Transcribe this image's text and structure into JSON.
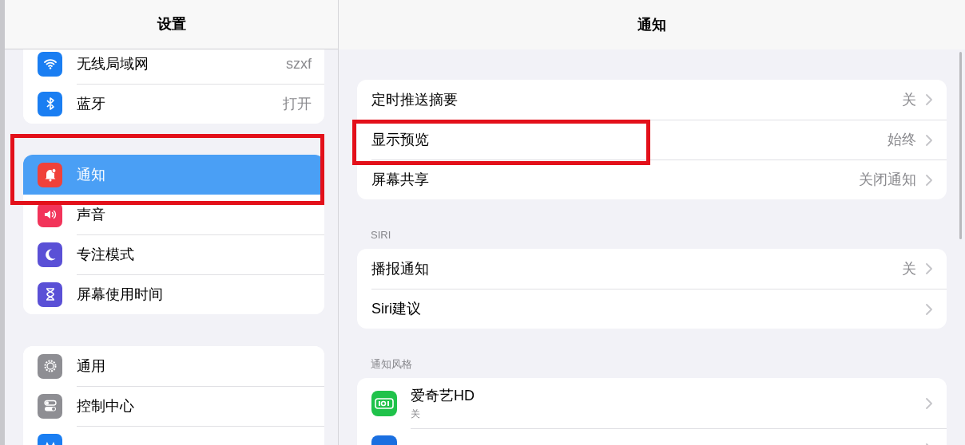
{
  "sidebar": {
    "title": "设置",
    "groups": [
      {
        "items": [
          {
            "label": "无线局域网",
            "value": "szxf",
            "selected": false
          },
          {
            "label": "蓝牙",
            "value": "打开",
            "selected": false
          }
        ]
      },
      {
        "items": [
          {
            "label": "通知",
            "selected": true
          },
          {
            "label": "声音",
            "selected": false
          },
          {
            "label": "专注模式",
            "selected": false
          },
          {
            "label": "屏幕使用时间",
            "selected": false
          }
        ]
      },
      {
        "items": [
          {
            "label": "通用",
            "selected": false
          },
          {
            "label": "控制中心",
            "selected": false
          },
          {
            "selected": false
          }
        ]
      }
    ]
  },
  "detail": {
    "title": "通知",
    "sections": [
      {
        "rows": [
          {
            "label": "定时推送摘要",
            "value": "关"
          },
          {
            "label": "显示预览",
            "value": "始终"
          },
          {
            "label": "屏幕共享",
            "value": "关闭通知"
          }
        ]
      },
      {
        "header": "SIRI",
        "rows": [
          {
            "label": "播报通知",
            "value": "关"
          },
          {
            "label": "Siri建议"
          }
        ]
      },
      {
        "header": "通知风格",
        "rows": [
          {
            "label": "爱奇艺HD",
            "subtitle": "关",
            "kind": "app"
          },
          {
            "kind": "app"
          }
        ]
      }
    ]
  },
  "annotations": [
    {
      "kind": "frame"
    },
    {
      "kind": "frame"
    }
  ]
}
